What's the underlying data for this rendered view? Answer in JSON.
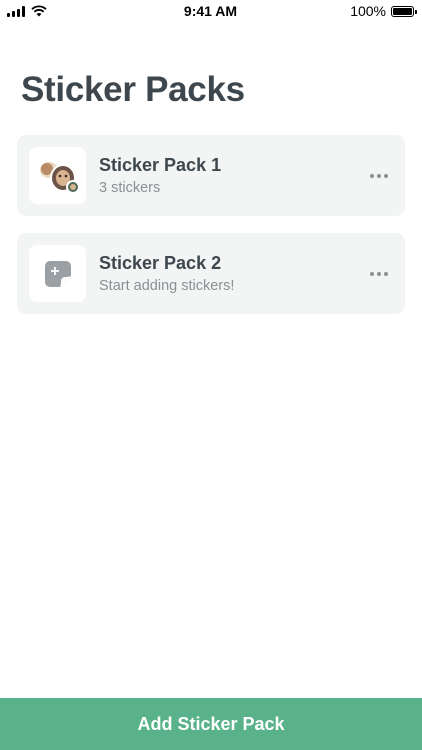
{
  "status_bar": {
    "time": "9:41 AM",
    "battery_text": "100%",
    "icons": [
      "signal-icon",
      "wifi-icon",
      "battery-icon"
    ]
  },
  "page": {
    "title": "Sticker Packs"
  },
  "packs": [
    {
      "name": "Sticker Pack 1",
      "subtitle": "3 stickers",
      "thumbnail": "sticker-collage-thumbnail",
      "more_icon": "more-horizontal-icon"
    },
    {
      "name": "Sticker Pack 2",
      "subtitle": "Start adding stickers!",
      "thumbnail": "add-sticker-icon",
      "more_icon": "more-horizontal-icon"
    }
  ],
  "footer": {
    "add_label": "Add Sticker Pack"
  },
  "colors": {
    "accent": "#59b289",
    "card_bg": "#f3f4f4",
    "title_text": "#3d474d",
    "secondary_text": "#8a9094"
  }
}
